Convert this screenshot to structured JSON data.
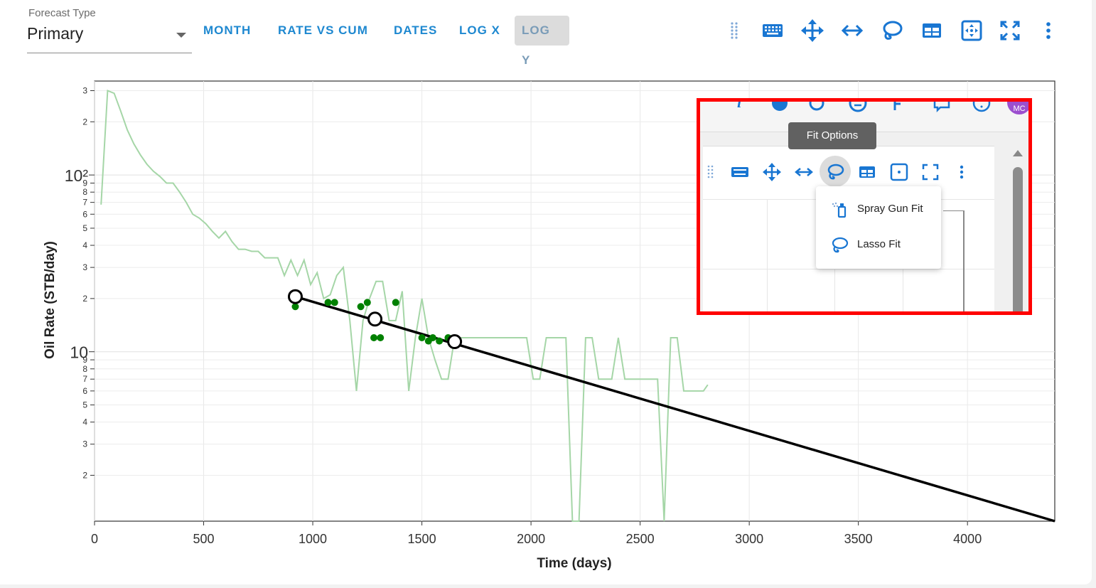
{
  "forecast": {
    "label": "Forecast Type",
    "value": "Primary"
  },
  "modes": [
    {
      "label": "MONTH",
      "active": false
    },
    {
      "label": "RATE VS CUM",
      "active": false
    },
    {
      "label": "DATES",
      "active": false
    },
    {
      "label": "LOG X",
      "active": false
    },
    {
      "label": "LOG Y",
      "active": true
    }
  ],
  "toolbar_icons": [
    "drag-handle-icon",
    "keyboard-icon",
    "pan-icon",
    "horizontal-arrows-icon",
    "lasso-icon",
    "table-icon",
    "zoom-select-icon",
    "fullscreen-icon",
    "more-vert-icon"
  ],
  "inset": {
    "tooltip": "Fit Options",
    "badge": "MC",
    "menu": [
      {
        "label": "Spray Gun Fit",
        "icon": "spray-gun-icon"
      },
      {
        "label": "Lasso Fit",
        "icon": "lasso-icon"
      }
    ]
  },
  "colors": {
    "accent": "#1976d2",
    "production": "#a5d6a7",
    "selected": "#008000",
    "fit": "#000000",
    "highlight": "#ff0000"
  },
  "chart_data": {
    "type": "line",
    "xlabel": "Time (days)",
    "ylabel": "Oil Rate (STB/day)",
    "x_ticks": [
      0,
      500,
      1000,
      1500,
      2000,
      2500,
      3000,
      3500,
      4000
    ],
    "y_scale": "log",
    "y_major_ticks": [
      {
        "value": 10,
        "label": "10"
      },
      {
        "value": 100,
        "label": "10²"
      }
    ],
    "y_minor_ticks": [
      {
        "value": 2,
        "label": "2"
      },
      {
        "value": 3,
        "label": "3"
      },
      {
        "value": 4,
        "label": "4"
      },
      {
        "value": 5,
        "label": "5"
      },
      {
        "value": 6,
        "label": "6"
      },
      {
        "value": 7,
        "label": "7"
      },
      {
        "value": 8,
        "label": "8"
      },
      {
        "value": 9,
        "label": "9"
      },
      {
        "value": 20,
        "label": "2"
      },
      {
        "value": 30,
        "label": "3"
      },
      {
        "value": 40,
        "label": "4"
      },
      {
        "value": 50,
        "label": "5"
      },
      {
        "value": 60,
        "label": "6"
      },
      {
        "value": 70,
        "label": "7"
      },
      {
        "value": 80,
        "label": "8"
      },
      {
        "value": 90,
        "label": "9"
      },
      {
        "value": 200,
        "label": "2"
      },
      {
        "value": 300,
        "label": "3"
      }
    ],
    "xlim": [
      0,
      4400
    ],
    "ylim": [
      1.1,
      340
    ],
    "grid": true,
    "series": [
      {
        "role": "production",
        "x": [
          30,
          60,
          90,
          120,
          150,
          180,
          210,
          240,
          270,
          300,
          330,
          360,
          390,
          420,
          450,
          480,
          510,
          540,
          570,
          600,
          630,
          660,
          690,
          720,
          750,
          780,
          810,
          840,
          870,
          900,
          930,
          960,
          990,
          1020,
          1050,
          1080,
          1110,
          1140,
          1170,
          1200,
          1230,
          1260,
          1290,
          1320,
          1350,
          1380,
          1410,
          1440,
          1470,
          1500,
          1530,
          1560,
          1590,
          1620,
          1650,
          1680,
          1710,
          1740,
          1770,
          1800,
          1830,
          1860,
          1890,
          1920,
          1950,
          1980,
          2010,
          2040,
          2070,
          2100,
          2130,
          2160,
          2190,
          2220,
          2250,
          2280,
          2310,
          2340,
          2370,
          2400,
          2430,
          2460,
          2490,
          2520,
          2550,
          2580,
          2610,
          2640,
          2670,
          2700,
          2730,
          2760,
          2790,
          2810
        ],
        "y": [
          68,
          300,
          290,
          230,
          180,
          150,
          130,
          115,
          105,
          98,
          90,
          90,
          80,
          70,
          60,
          57,
          53,
          48,
          44,
          48,
          42,
          38,
          38,
          37,
          37,
          34,
          34,
          34,
          27,
          33,
          27,
          33,
          24,
          28,
          20,
          21,
          27,
          30,
          15,
          6,
          15,
          20,
          25,
          25,
          15,
          15,
          22,
          6,
          12,
          20,
          12,
          9,
          7,
          7,
          12,
          12,
          12,
          12,
          12,
          12,
          12,
          12,
          12,
          12,
          12,
          12,
          7,
          7,
          12,
          12,
          12,
          12,
          1.1,
          1.1,
          12,
          12,
          7,
          7,
          7,
          12,
          7,
          7,
          7,
          7,
          7,
          7,
          1.1,
          12,
          12,
          6,
          6,
          6,
          6,
          6.5
        ]
      },
      {
        "role": "selected_points",
        "x": [
          920,
          1070,
          1100,
          1220,
          1250,
          1280,
          1310,
          1380,
          1500,
          1530,
          1550,
          1580,
          1620
        ],
        "y": [
          18,
          19,
          19,
          18,
          19,
          12,
          12,
          19,
          12,
          11.5,
          12,
          11.5,
          12
        ]
      },
      {
        "role": "fit_line",
        "x": [
          920,
          4400
        ],
        "y": [
          20.5,
          1.1
        ]
      },
      {
        "role": "fit_handles",
        "x": [
          920,
          1285,
          1650
        ],
        "y": [
          20.5,
          15.3,
          11.4
        ]
      }
    ]
  }
}
